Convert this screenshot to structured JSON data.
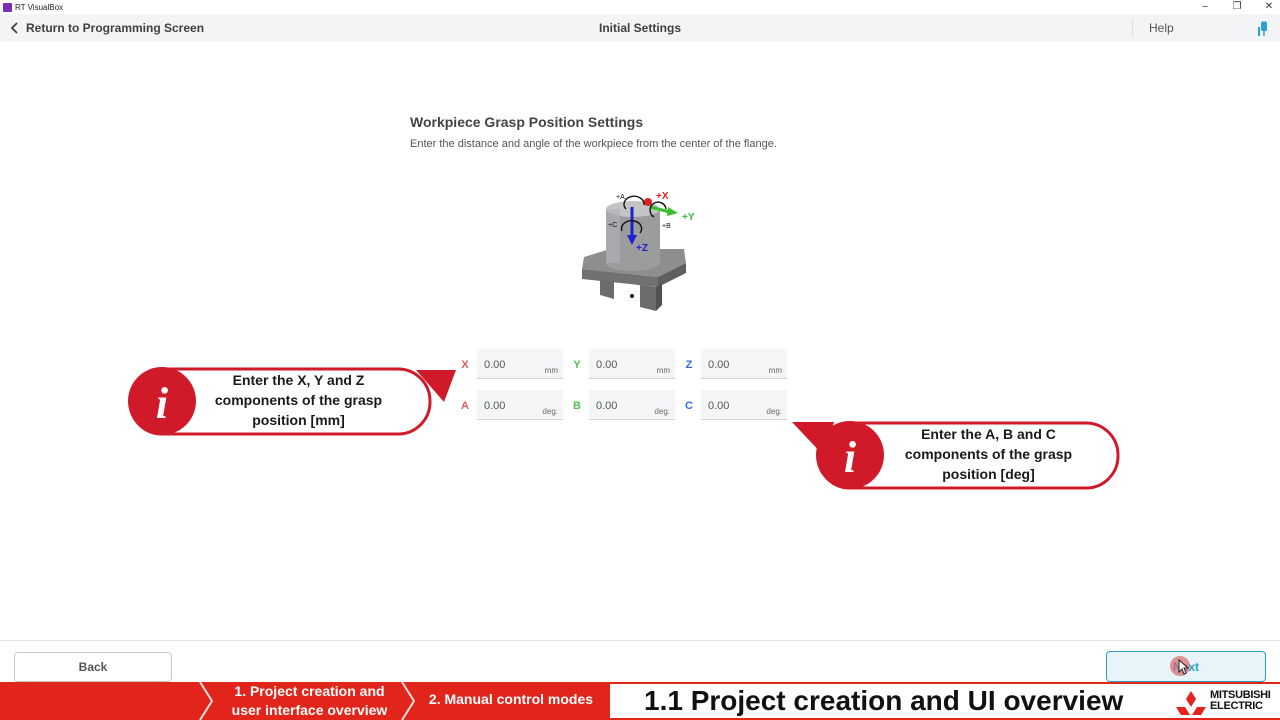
{
  "window": {
    "title": "RT VisualBox",
    "controls": [
      "–",
      "❐",
      "✕"
    ]
  },
  "header": {
    "back_label": "Return to Programming Screen",
    "title": "Initial Settings",
    "help_label": "Help"
  },
  "section": {
    "title": "Workpiece Grasp Position Settings",
    "description": "Enter the distance and angle of the workpiece from the center of the flange."
  },
  "diagram": {
    "labels": {
      "x": "+X",
      "y": "+Y",
      "z": "+Z",
      "a": "+A",
      "b": "+B",
      "c": "+C"
    }
  },
  "fields": {
    "x": {
      "label": "X",
      "value": "0.00",
      "unit": "mm",
      "color": "#e05a5a"
    },
    "y": {
      "label": "Y",
      "value": "0.00",
      "unit": "mm",
      "color": "#55c050"
    },
    "z": {
      "label": "Z",
      "value": "0.00",
      "unit": "mm",
      "color": "#2f6fd0"
    },
    "a": {
      "label": "A",
      "value": "0.00",
      "unit": "deg.",
      "color": "#e05a5a"
    },
    "b": {
      "label": "B",
      "value": "0.00",
      "unit": "deg.",
      "color": "#55c050"
    },
    "c": {
      "label": "C",
      "value": "0.00",
      "unit": "deg.",
      "color": "#2f6fd0"
    }
  },
  "callouts": {
    "left": {
      "icon": "i",
      "line1": "Enter the X, Y and Z",
      "line2": "components of the grasp",
      "line3": "position [mm]"
    },
    "right": {
      "icon": "i",
      "line1": "Enter the A, B and C",
      "line2": "components of the grasp",
      "line3": "position [deg]"
    }
  },
  "footer": {
    "back_label": "Back",
    "next_label": "Next"
  },
  "banner": {
    "item1_line1": "1. Project creation and",
    "item1_line2": "user interface overview",
    "item2": "2. Manual control modes",
    "title": "1.1 Project creation and UI overview",
    "brand_line1": "MITSUBISHI",
    "brand_line2": "ELECTRIC"
  },
  "colors": {
    "accent_red": "#e1251b",
    "next_blue": "#2a9fd0"
  }
}
